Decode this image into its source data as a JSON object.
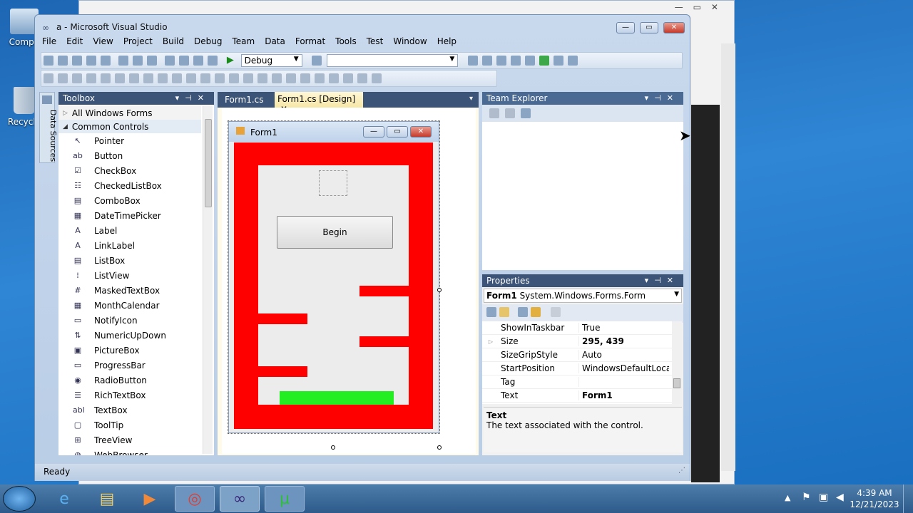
{
  "desktop": {
    "icons": [
      {
        "label": "Compu"
      },
      {
        "label": "Recycle"
      }
    ]
  },
  "vs": {
    "title": "a - Microsoft Visual Studio",
    "menu": [
      "File",
      "Edit",
      "View",
      "Project",
      "Build",
      "Debug",
      "Team",
      "Data",
      "Format",
      "Tools",
      "Test",
      "Window",
      "Help"
    ],
    "config": "Debug",
    "status": "Ready"
  },
  "sidebar": {
    "data_sources": "Data Sources"
  },
  "toolbox": {
    "title": "Toolbox",
    "group_all": "All Windows Forms",
    "group_common": "Common Controls",
    "items": [
      {
        "label": "Pointer",
        "icon": "↖"
      },
      {
        "label": "Button",
        "icon": "ab"
      },
      {
        "label": "CheckBox",
        "icon": "☑"
      },
      {
        "label": "CheckedListBox",
        "icon": "☷"
      },
      {
        "label": "ComboBox",
        "icon": "▤"
      },
      {
        "label": "DateTimePicker",
        "icon": "▦"
      },
      {
        "label": "Label",
        "icon": "A"
      },
      {
        "label": "LinkLabel",
        "icon": "A"
      },
      {
        "label": "ListBox",
        "icon": "▤"
      },
      {
        "label": "ListView",
        "icon": "⁞"
      },
      {
        "label": "MaskedTextBox",
        "icon": "#"
      },
      {
        "label": "MonthCalendar",
        "icon": "▦"
      },
      {
        "label": "NotifyIcon",
        "icon": "▭"
      },
      {
        "label": "NumericUpDown",
        "icon": "⇅"
      },
      {
        "label": "PictureBox",
        "icon": "▣"
      },
      {
        "label": "ProgressBar",
        "icon": "▭"
      },
      {
        "label": "RadioButton",
        "icon": "◉"
      },
      {
        "label": "RichTextBox",
        "icon": "☰"
      },
      {
        "label": "TextBox",
        "icon": "abl"
      },
      {
        "label": "ToolTip",
        "icon": "▢"
      },
      {
        "label": "TreeView",
        "icon": "⊞"
      },
      {
        "label": "WebBrowser",
        "icon": "◍"
      }
    ]
  },
  "tabs": [
    {
      "label": "Form1.cs"
    },
    {
      "label": "Form1.cs [Design]"
    }
  ],
  "designer": {
    "form_title": "Form1",
    "button_label": "Begin"
  },
  "team_explorer": {
    "title": "Team Explorer"
  },
  "properties": {
    "title": "Properties",
    "object_name": "Form1",
    "object_type": "System.Windows.Forms.Form",
    "rows": [
      {
        "name": "ShowInTaskbar",
        "value": "True"
      },
      {
        "name": "Size",
        "value": "295, 439"
      },
      {
        "name": "SizeGripStyle",
        "value": "Auto"
      },
      {
        "name": "StartPosition",
        "value": "WindowsDefaultLocatio"
      },
      {
        "name": "Tag",
        "value": ""
      },
      {
        "name": "Text",
        "value": "Form1"
      }
    ],
    "desc_title": "Text",
    "desc_text": "The text associated with the control."
  },
  "taskbar": {
    "time": "4:39 AM",
    "date": "12/21/2023"
  }
}
